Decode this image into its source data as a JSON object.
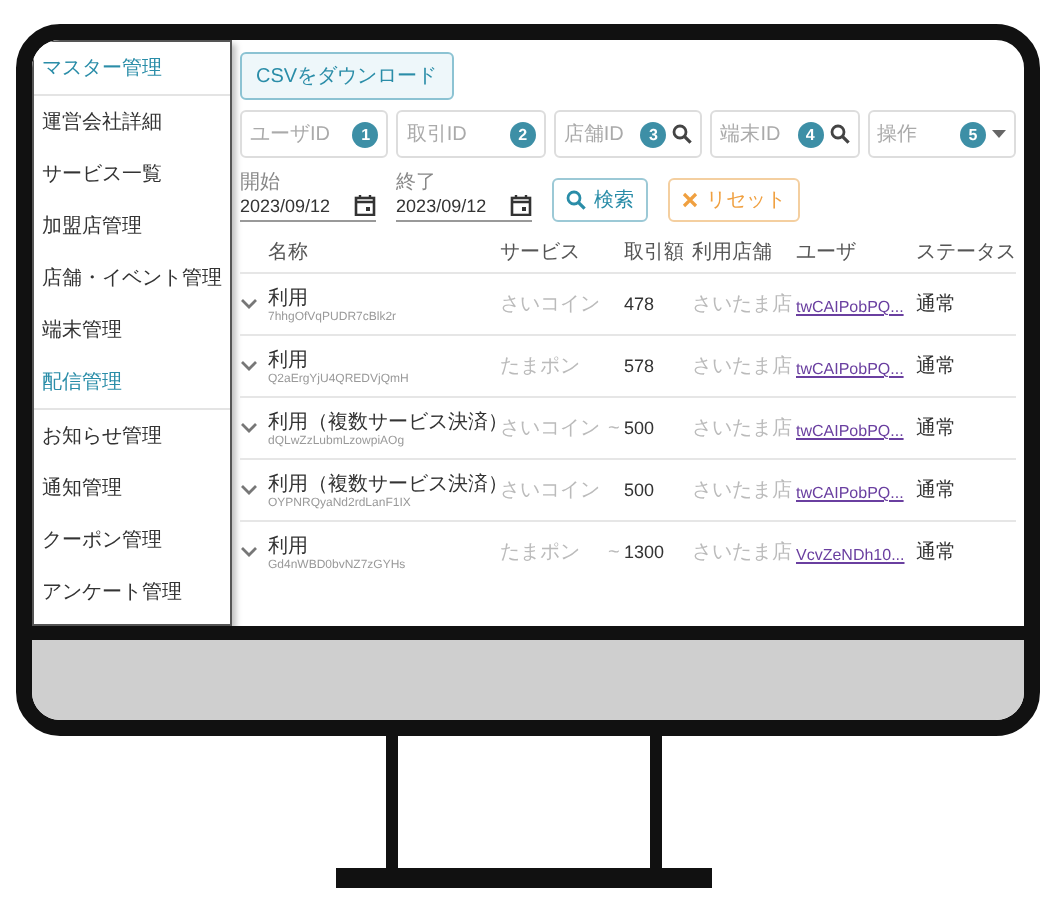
{
  "sidebar": {
    "items": [
      {
        "kind": "section",
        "label": "マスター管理"
      },
      {
        "kind": "item",
        "label": "運営会社詳細"
      },
      {
        "kind": "item",
        "label": "サービス一覧"
      },
      {
        "kind": "item",
        "label": "加盟店管理"
      },
      {
        "kind": "item",
        "label": "店舗・イベント管理"
      },
      {
        "kind": "item",
        "label": "端末管理"
      },
      {
        "kind": "section",
        "label": "配信管理"
      },
      {
        "kind": "item",
        "label": "お知らせ管理"
      },
      {
        "kind": "item",
        "label": "通知管理"
      },
      {
        "kind": "item",
        "label": "クーポン管理"
      },
      {
        "kind": "item",
        "label": "アンケート管理"
      }
    ]
  },
  "download_button": "CSVをダウンロード",
  "filters": [
    {
      "kind": "text",
      "placeholder": "ユーザID",
      "badge": "1"
    },
    {
      "kind": "text",
      "placeholder": "取引ID",
      "badge": "2"
    },
    {
      "kind": "search",
      "placeholder": "店舗ID",
      "badge": "3"
    },
    {
      "kind": "search",
      "placeholder": "端末ID",
      "badge": "4"
    },
    {
      "kind": "select",
      "placeholder": "操作",
      "badge": "5"
    }
  ],
  "date_range": [
    {
      "label": "開始",
      "value": "2023/09/12"
    },
    {
      "label": "終了",
      "value": "2023/09/12"
    }
  ],
  "buttons": [
    {
      "kind": "search",
      "label": "検索"
    },
    {
      "kind": "reset",
      "label": "リセット"
    }
  ],
  "table": {
    "columns": [
      "名称",
      "サービス",
      "取引額",
      "利用店舗",
      "ユーザ",
      "ステータス"
    ],
    "rows": [
      {
        "name": "利用",
        "id": "7hhgOfVqPUDR7cBlk2r",
        "service": "さいコイン",
        "mark": "",
        "amount": "478",
        "store": "さいたま店",
        "user": "twCAIPobPQ...",
        "status": "通常"
      },
      {
        "name": "利用",
        "id": "Q2aErgYjU4QREDVjQmH",
        "service": "たまポン",
        "mark": "",
        "amount": "578",
        "store": "さいたま店",
        "user": "twCAIPobPQ...",
        "status": "通常"
      },
      {
        "name": "利用（複数サービス決済）",
        "id": "dQLwZzLubmLzowpiAOg",
        "service": "さいコイン",
        "mark": "~",
        "amount": "500",
        "store": "さいたま店",
        "user": "twCAIPobPQ...",
        "status": "通常"
      },
      {
        "name": "利用（複数サービス決済）",
        "id": "OYPNRQyaNd2rdLanF1IX",
        "service": "さいコイン",
        "mark": "",
        "amount": "500",
        "store": "さいたま店",
        "user": "twCAIPobPQ...",
        "status": "通常"
      },
      {
        "name": "利用",
        "id": "Gd4nWBD0bvNZ7zGYHs",
        "service": "たまポン",
        "mark": "~",
        "amount": "1300",
        "store": "さいたま店",
        "user": "VcvZeNDh10...",
        "status": "通常"
      }
    ]
  }
}
